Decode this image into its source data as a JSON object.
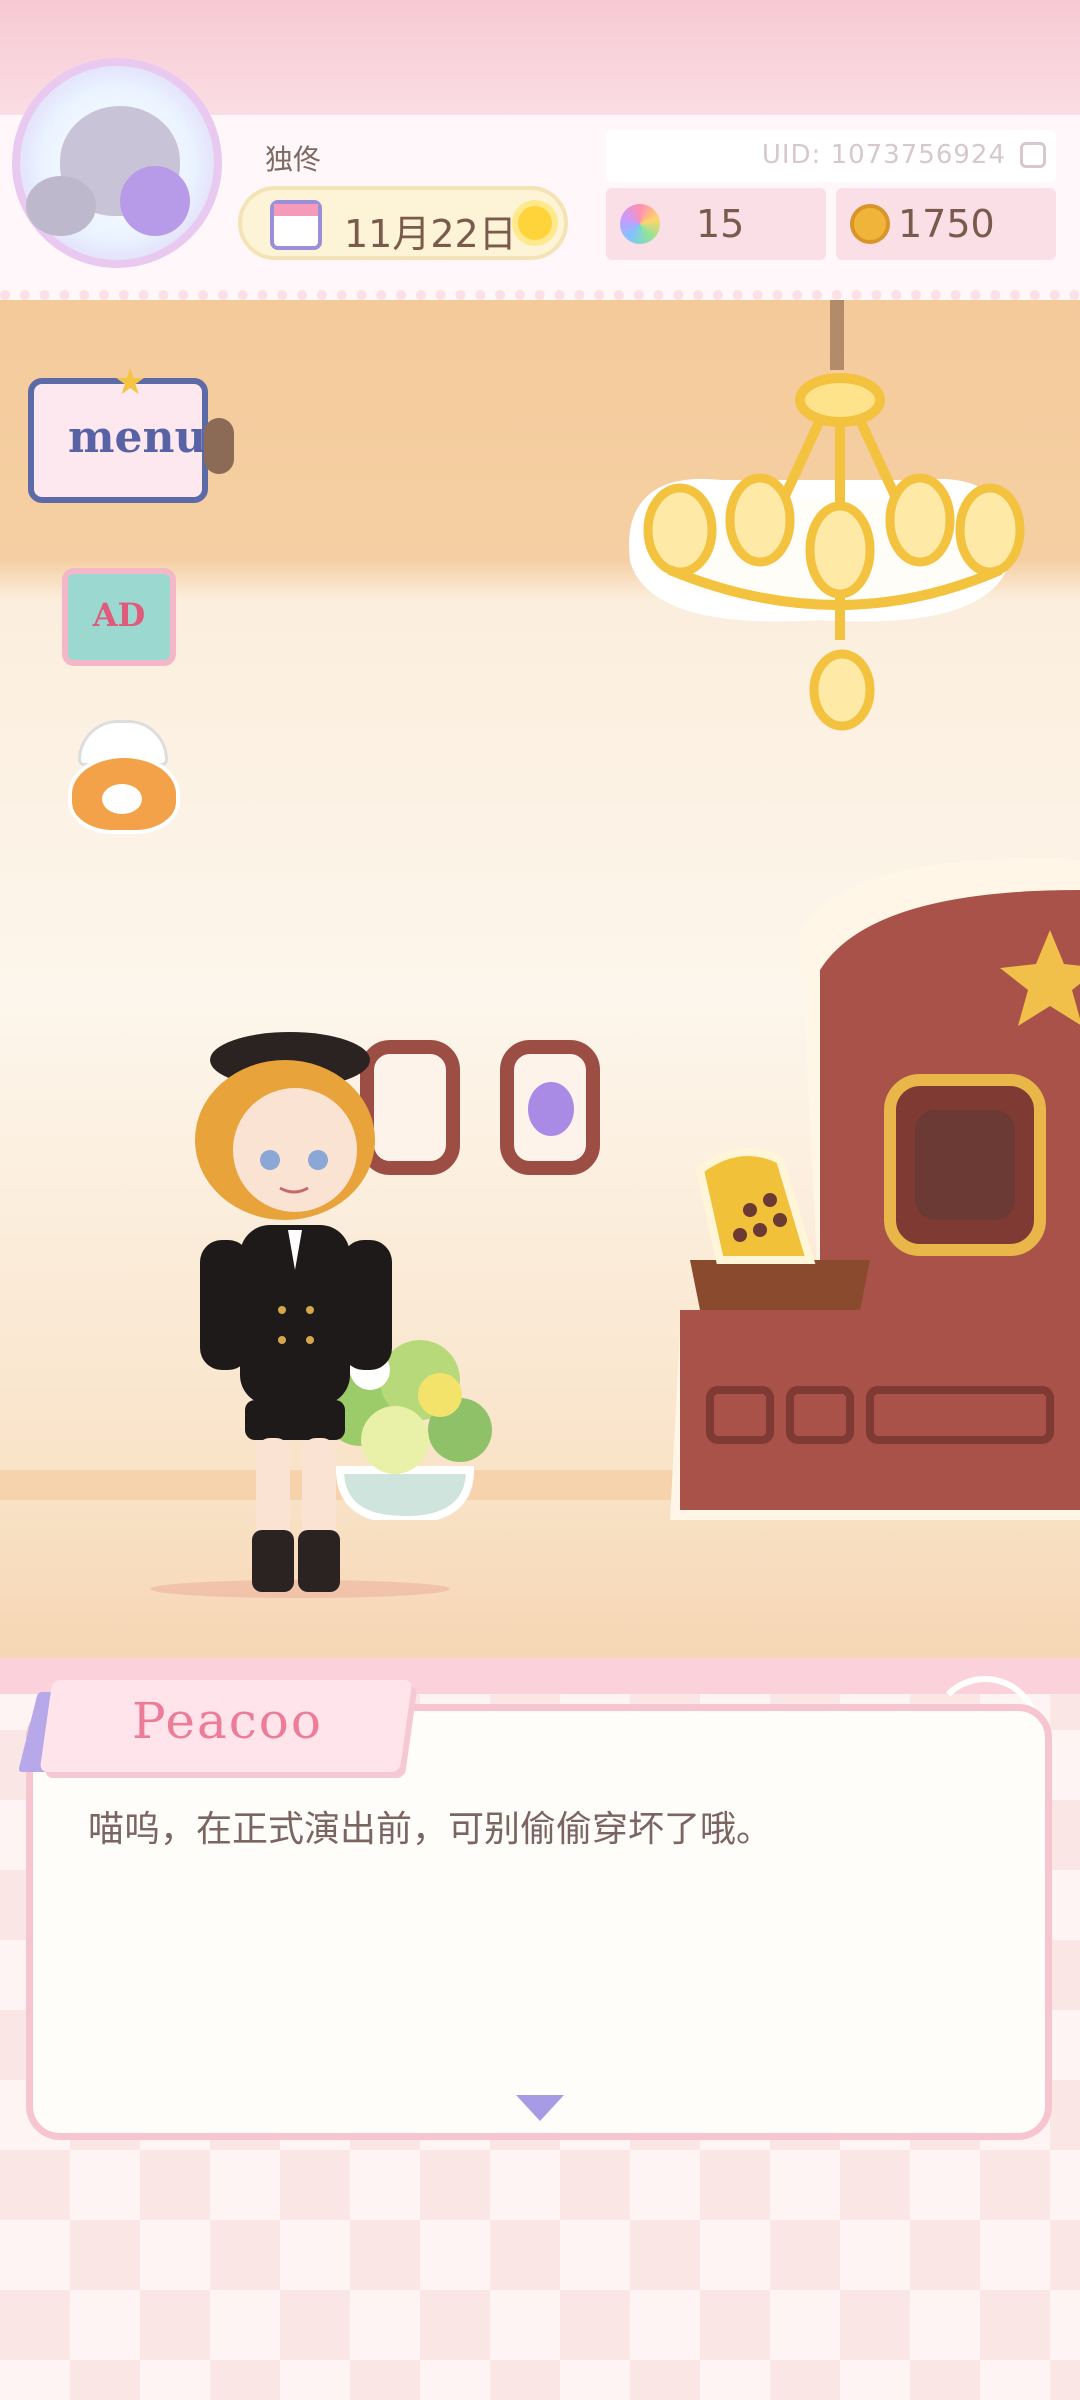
{
  "hud": {
    "player_name": "独佟",
    "date": "11月22日",
    "uid": "UID: 1073756924",
    "gems": "15",
    "coins": "1750"
  },
  "side_buttons": {
    "menu_label": "menu",
    "ad_label": "AD"
  },
  "dialog": {
    "speaker": "Peacoo",
    "text": "喵呜，在正式演出前，可别偷偷穿坏了哦。"
  },
  "colors": {
    "accent_pink": "#f7c5cf",
    "speaker_pink": "#ec7c98",
    "text_brown": "#7a5a4c",
    "cabinet_red": "#9c4e45",
    "chandelier_gold": "#f3c23f"
  },
  "icons": [
    "avatar-cats",
    "calendar-icon",
    "sun-icon",
    "copy-icon",
    "gem-icon",
    "coin-icon",
    "menu-book-icon",
    "ad-tv-icon",
    "chef-hamster-icon",
    "next-arrow-icon"
  ]
}
